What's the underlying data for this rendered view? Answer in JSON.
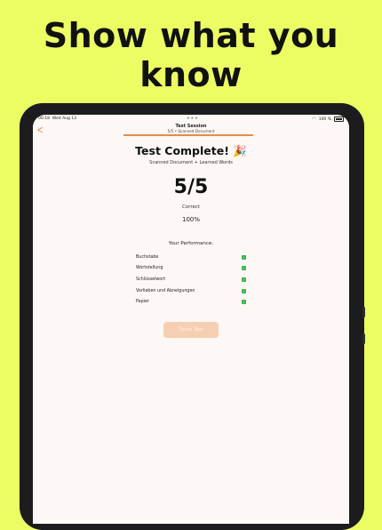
{
  "headline": {
    "line1": "Show what you",
    "line2": "know"
  },
  "status_bar": {
    "time": "00:18",
    "date": "Wed Aug 13",
    "battery": "100 %"
  },
  "nav": {
    "back_icon": "chevron-left-icon",
    "session_title": "Test Session",
    "session_subtitle": "5/5 • Scanned Document"
  },
  "progress": {
    "fraction": 1.0
  },
  "result": {
    "title": "Test Complete! 🎉",
    "subtitle": "Scanned Document + Learned Words",
    "score": "5/5",
    "correct_label": "Correct",
    "percent": "100%"
  },
  "performance": {
    "title": "Your Performance:",
    "items": [
      {
        "word": "Buchstabe",
        "status": "correct"
      },
      {
        "word": "Wortstellung",
        "status": "correct"
      },
      {
        "word": "Schlüsselwort",
        "status": "correct"
      },
      {
        "word": "Vorlieben und Abneigungen",
        "status": "correct"
      },
      {
        "word": "Papier",
        "status": "correct"
      }
    ]
  },
  "finish_button": {
    "label": "Finish Test"
  },
  "colors": {
    "accent": "#e8894a",
    "background": "#ecfd63",
    "check": "#36b24a"
  }
}
